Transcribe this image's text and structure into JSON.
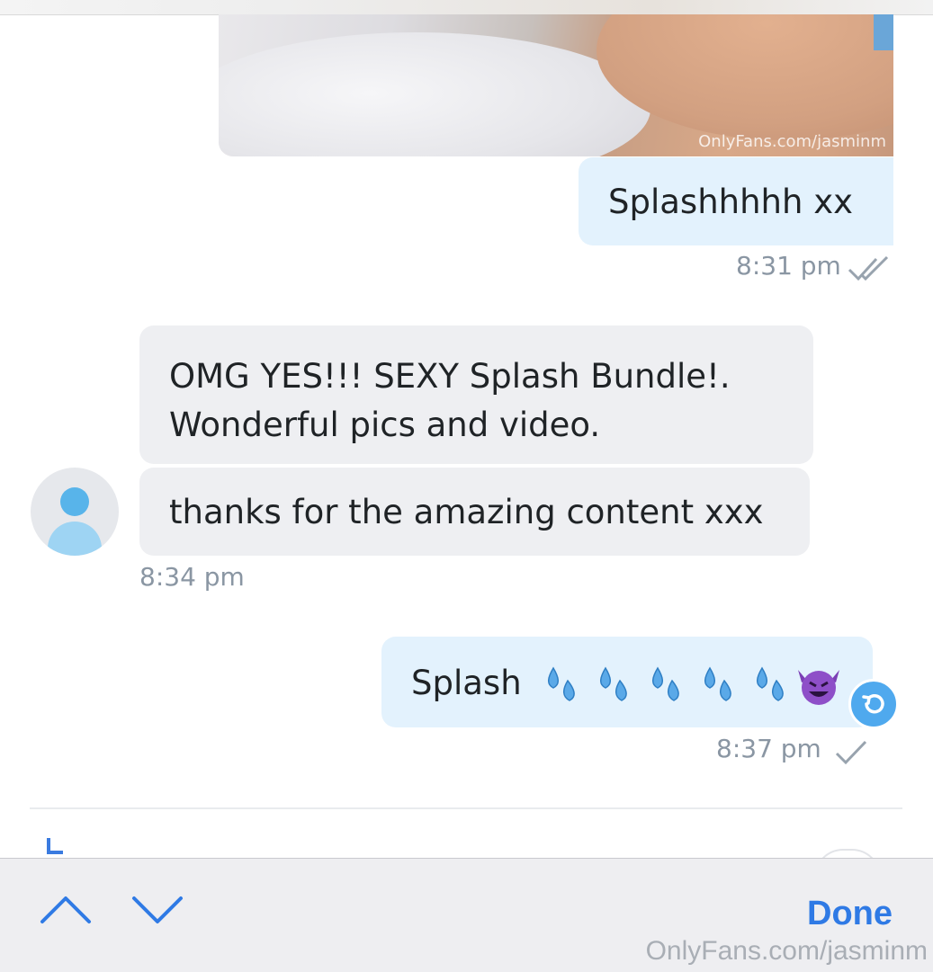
{
  "chat": {
    "image_watermark": "OnlyFans.com/jasminm",
    "messages": [
      {
        "direction": "sent",
        "text": "Splashhhhh xx",
        "time": "8:31 pm",
        "status": "read"
      },
      {
        "direction": "received",
        "text": "OMG YES!!! SEXY Splash Bundle!. Wonderful pics and video.",
        "time": ""
      },
      {
        "direction": "received",
        "text": "thanks for the amazing content xxx",
        "time": "8:34 pm"
      },
      {
        "direction": "sent",
        "text": "Splash",
        "emoji": "💦💦💦💦💦😈",
        "time": "8:37 pm",
        "status": "sent"
      }
    ]
  },
  "toolbar": {
    "prev_icon": "chevron-up-icon",
    "next_icon": "chevron-down-icon",
    "done_label": "Done"
  },
  "footer": {
    "watermark": "OnlyFans.com/jasminm"
  },
  "colors": {
    "sent_bubble": "#e3f2fd",
    "received_bubble": "#eeeff2",
    "accent": "#2f7ae5",
    "timestamp": "#8a96a3"
  }
}
